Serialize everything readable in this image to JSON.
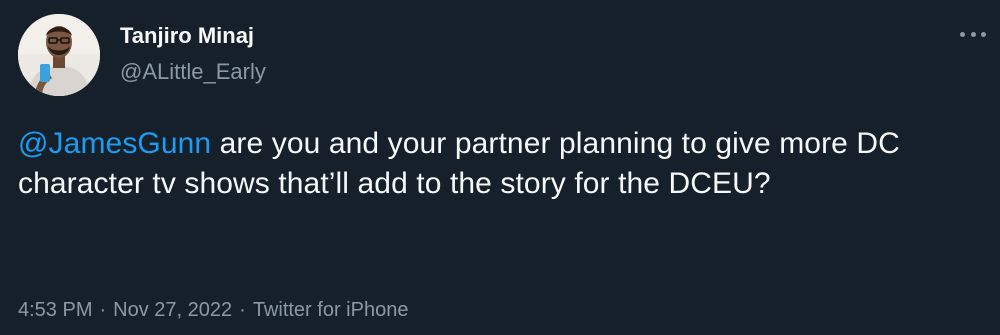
{
  "author": {
    "display_name": "Tanjiro Minaj",
    "handle": "@ALittle_Early"
  },
  "tweet": {
    "mention": "@JamesGunn",
    "text": " are you and your partner planning to give more DC character tv shows that’ll add to the story for the DCEU?"
  },
  "meta": {
    "time": "4:53 PM",
    "separator": "·",
    "date": "Nov 27, 2022",
    "source": "Twitter for iPhone"
  },
  "icons": {
    "more": "more-options-icon"
  },
  "colors": {
    "background": "#15202b",
    "text": "#f7f9f9",
    "secondary": "#8b98a5",
    "link": "#1d9bf0"
  }
}
